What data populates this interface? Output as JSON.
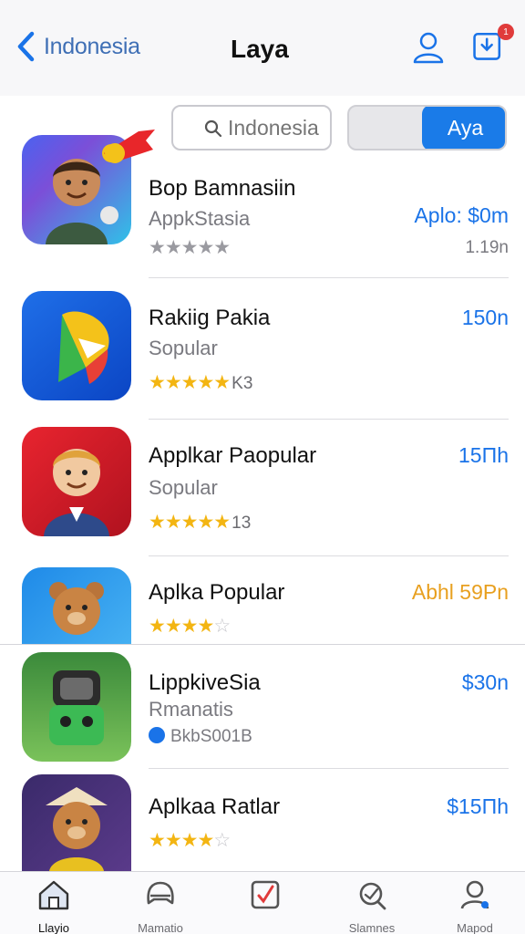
{
  "header": {
    "back_label": "Indonesia",
    "title": "Laya",
    "inbox_badge": "1"
  },
  "search": {
    "placeholder": "Indonesia",
    "toggle_label": "Aya"
  },
  "apps": [
    {
      "name": "Bop Bamnasiin",
      "subtitle": "AppkStasia",
      "price": "Aplo: $0m",
      "size": "1.19n",
      "rating": 5,
      "rating_gray": true,
      "rating_count": ""
    },
    {
      "name": "Rakiig Pakia",
      "subtitle": "Sopular",
      "price": "150n",
      "rating": 5,
      "rating_count": "K3"
    },
    {
      "name": "Applkar Paopular",
      "subtitle": "Sopular",
      "price": "15Πh",
      "rating": 5,
      "rating_count": "13"
    },
    {
      "name": "Aplka Popular",
      "price": "Abhl 59Pn",
      "price_color": "#e8a020",
      "rating": 3.5,
      "rating_count": ""
    },
    {
      "name": "LippkiveSia",
      "subtitle": "Rmanatis",
      "developer": "BkbS001B",
      "price": "$30n"
    },
    {
      "name": "Aplkaa Ratlar",
      "price": "$15Πh",
      "rating": 4.5,
      "rating_count": ""
    }
  ],
  "tabs": [
    {
      "label": "Llayio",
      "icon": "home-icon"
    },
    {
      "label": "Mamatio",
      "icon": "gamepad-icon"
    },
    {
      "label": "",
      "icon": "apps-icon"
    },
    {
      "label": "Slamnes",
      "icon": "search-icon"
    },
    {
      "label": "Mapod",
      "icon": "profile-icon"
    }
  ],
  "colors": {
    "accent": "#1a73e8",
    "star": "#f3b512",
    "badge": "#e03b3b"
  }
}
